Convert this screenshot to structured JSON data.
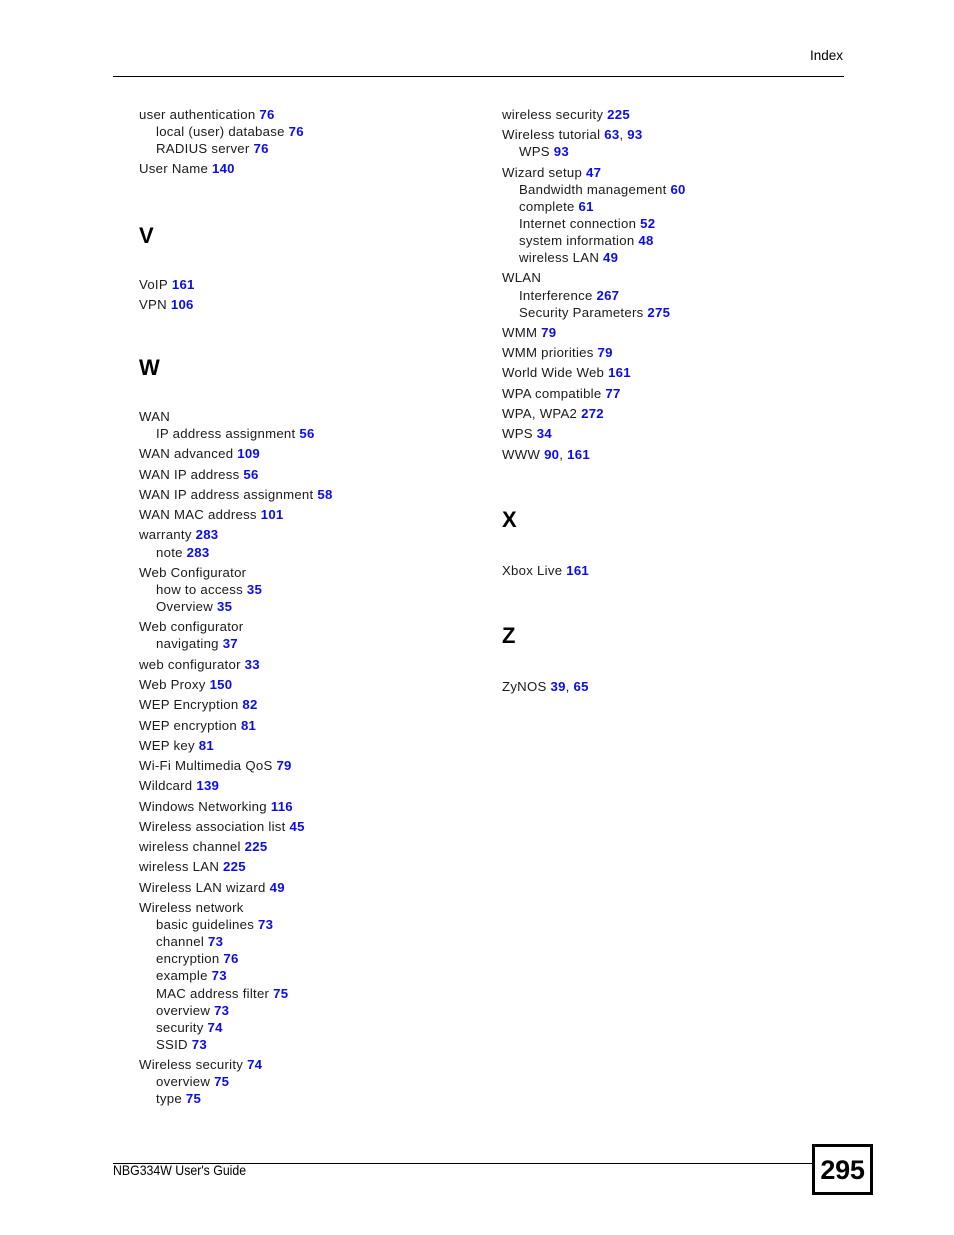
{
  "header": {
    "title": "Index"
  },
  "footer": {
    "guide_title": "NBG334W User's Guide",
    "page_number": "295"
  },
  "colors": {
    "page_number_link": "#0b0bef",
    "text": "#1a1a1a",
    "rule": "#000000"
  },
  "columns": {
    "left": [
      {
        "kind": "entry",
        "level": 0,
        "text": "user authentication",
        "pages": [
          "76"
        ]
      },
      {
        "kind": "entry",
        "level": 1,
        "text": "local (user) database",
        "pages": [
          "76"
        ]
      },
      {
        "kind": "entry",
        "level": 1,
        "text": "RADIUS server",
        "pages": [
          "76"
        ]
      },
      {
        "kind": "entry",
        "level": 0,
        "text": "User Name",
        "pages": [
          "140"
        ]
      },
      {
        "kind": "letter",
        "text": "V"
      },
      {
        "kind": "entry",
        "level": 0,
        "text": "VoIP",
        "pages": [
          "161"
        ]
      },
      {
        "kind": "entry",
        "level": 0,
        "text": "VPN",
        "pages": [
          "106"
        ]
      },
      {
        "kind": "letter",
        "text": "W"
      },
      {
        "kind": "entry",
        "level": 0,
        "text": "WAN",
        "pages": []
      },
      {
        "kind": "entry",
        "level": 1,
        "text": "IP address assignment",
        "pages": [
          "56"
        ]
      },
      {
        "kind": "entry",
        "level": 0,
        "text": "WAN advanced",
        "pages": [
          "109"
        ]
      },
      {
        "kind": "entry",
        "level": 0,
        "text": "WAN IP address",
        "pages": [
          "56"
        ]
      },
      {
        "kind": "entry",
        "level": 0,
        "text": "WAN IP address assignment",
        "pages": [
          "58"
        ]
      },
      {
        "kind": "entry",
        "level": 0,
        "text": "WAN MAC address",
        "pages": [
          "101"
        ]
      },
      {
        "kind": "entry",
        "level": 0,
        "text": "warranty",
        "pages": [
          "283"
        ]
      },
      {
        "kind": "entry",
        "level": 1,
        "text": "note",
        "pages": [
          "283"
        ]
      },
      {
        "kind": "entry",
        "level": 0,
        "text": "Web Configurator",
        "pages": []
      },
      {
        "kind": "entry",
        "level": 1,
        "text": "how to access",
        "pages": [
          "35"
        ]
      },
      {
        "kind": "entry",
        "level": 1,
        "text": "Overview",
        "pages": [
          "35"
        ]
      },
      {
        "kind": "entry",
        "level": 0,
        "text": "Web configurator",
        "pages": []
      },
      {
        "kind": "entry",
        "level": 1,
        "text": "navigating",
        "pages": [
          "37"
        ]
      },
      {
        "kind": "entry",
        "level": 0,
        "text": "web configurator",
        "pages": [
          "33"
        ]
      },
      {
        "kind": "entry",
        "level": 0,
        "text": "Web Proxy",
        "pages": [
          "150"
        ]
      },
      {
        "kind": "entry",
        "level": 0,
        "text": "WEP Encryption",
        "pages": [
          "82"
        ]
      },
      {
        "kind": "entry",
        "level": 0,
        "text": "WEP encryption",
        "pages": [
          "81"
        ]
      },
      {
        "kind": "entry",
        "level": 0,
        "text": "WEP key",
        "pages": [
          "81"
        ]
      },
      {
        "kind": "entry",
        "level": 0,
        "text": "Wi-Fi Multimedia QoS",
        "pages": [
          "79"
        ]
      },
      {
        "kind": "entry",
        "level": 0,
        "text": "Wildcard",
        "pages": [
          "139"
        ]
      },
      {
        "kind": "entry",
        "level": 0,
        "text": "Windows Networking",
        "pages": [
          "116"
        ]
      },
      {
        "kind": "entry",
        "level": 0,
        "text": "Wireless association list",
        "pages": [
          "45"
        ]
      },
      {
        "kind": "entry",
        "level": 0,
        "text": "wireless channel",
        "pages": [
          "225"
        ]
      },
      {
        "kind": "entry",
        "level": 0,
        "text": "wireless LAN",
        "pages": [
          "225"
        ]
      },
      {
        "kind": "entry",
        "level": 0,
        "text": "Wireless LAN wizard",
        "pages": [
          "49"
        ]
      },
      {
        "kind": "entry",
        "level": 0,
        "text": "Wireless network",
        "pages": []
      },
      {
        "kind": "entry",
        "level": 1,
        "text": "basic guidelines",
        "pages": [
          "73"
        ]
      },
      {
        "kind": "entry",
        "level": 1,
        "text": "channel",
        "pages": [
          "73"
        ]
      },
      {
        "kind": "entry",
        "level": 1,
        "text": "encryption",
        "pages": [
          "76"
        ]
      },
      {
        "kind": "entry",
        "level": 1,
        "text": "example",
        "pages": [
          "73"
        ]
      },
      {
        "kind": "entry",
        "level": 1,
        "text": "MAC address filter",
        "pages": [
          "75"
        ]
      },
      {
        "kind": "entry",
        "level": 1,
        "text": "overview",
        "pages": [
          "73"
        ]
      },
      {
        "kind": "entry",
        "level": 1,
        "text": "security",
        "pages": [
          "74"
        ]
      },
      {
        "kind": "entry",
        "level": 1,
        "text": "SSID",
        "pages": [
          "73"
        ]
      },
      {
        "kind": "entry",
        "level": 0,
        "text": "Wireless security",
        "pages": [
          "74"
        ]
      },
      {
        "kind": "entry",
        "level": 1,
        "text": "overview",
        "pages": [
          "75"
        ]
      },
      {
        "kind": "entry",
        "level": 1,
        "text": "type",
        "pages": [
          "75"
        ]
      }
    ],
    "right": [
      {
        "kind": "entry",
        "level": 0,
        "text": "wireless security",
        "pages": [
          "225"
        ]
      },
      {
        "kind": "entry",
        "level": 0,
        "text": "Wireless tutorial",
        "pages": [
          "63",
          "93"
        ]
      },
      {
        "kind": "entry",
        "level": 1,
        "text": "WPS",
        "pages": [
          "93"
        ]
      },
      {
        "kind": "entry",
        "level": 0,
        "text": "Wizard setup",
        "pages": [
          "47"
        ]
      },
      {
        "kind": "entry",
        "level": 1,
        "text": "Bandwidth management",
        "pages": [
          "60"
        ]
      },
      {
        "kind": "entry",
        "level": 1,
        "text": "complete",
        "pages": [
          "61"
        ]
      },
      {
        "kind": "entry",
        "level": 1,
        "text": "Internet connection",
        "pages": [
          "52"
        ]
      },
      {
        "kind": "entry",
        "level": 1,
        "text": "system information",
        "pages": [
          "48"
        ]
      },
      {
        "kind": "entry",
        "level": 1,
        "text": "wireless LAN",
        "pages": [
          "49"
        ]
      },
      {
        "kind": "entry",
        "level": 0,
        "text": "WLAN",
        "pages": []
      },
      {
        "kind": "entry",
        "level": 1,
        "text": "Interference",
        "pages": [
          "267"
        ]
      },
      {
        "kind": "entry",
        "level": 1,
        "text": "Security Parameters",
        "pages": [
          "275"
        ]
      },
      {
        "kind": "entry",
        "level": 0,
        "text": "WMM",
        "pages": [
          "79"
        ]
      },
      {
        "kind": "entry",
        "level": 0,
        "text": "WMM priorities",
        "pages": [
          "79"
        ]
      },
      {
        "kind": "entry",
        "level": 0,
        "text": "World Wide Web",
        "pages": [
          "161"
        ]
      },
      {
        "kind": "entry",
        "level": 0,
        "text": "WPA compatible",
        "pages": [
          "77"
        ]
      },
      {
        "kind": "entry",
        "level": 0,
        "text": "WPA, WPA2",
        "pages": [
          "272"
        ]
      },
      {
        "kind": "entry",
        "level": 0,
        "text": "WPS",
        "pages": [
          "34"
        ]
      },
      {
        "kind": "entry",
        "level": 0,
        "text": "WWW",
        "pages": [
          "90",
          "161"
        ]
      },
      {
        "kind": "letter",
        "text": "X"
      },
      {
        "kind": "entry",
        "level": 0,
        "text": "Xbox Live",
        "pages": [
          "161"
        ]
      },
      {
        "kind": "letter",
        "text": "Z"
      },
      {
        "kind": "entry",
        "level": 0,
        "text": "ZyNOS",
        "pages": [
          "39",
          "65"
        ]
      }
    ]
  }
}
